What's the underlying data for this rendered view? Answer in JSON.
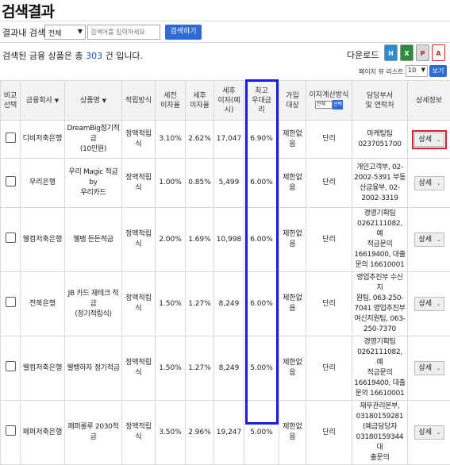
{
  "title": "검색결과",
  "search": {
    "label": "결과내 검색",
    "select_value": "전체",
    "placeholder": "검색어를 입력하세요",
    "button": "검색하기"
  },
  "result": {
    "prefix": "검색된 금융 상품은 총",
    "count": "303",
    "suffix": "건 입니다."
  },
  "download": {
    "label": "다운로드",
    "icons": [
      "hwp-icon",
      "excel-icon",
      "ppt-icon",
      "pdf-icon"
    ]
  },
  "paging": {
    "label": "페이지 뷰 리스트 :",
    "value": "10",
    "button": "보기"
  },
  "columns": {
    "compare": "비교\n선택",
    "company": "금융회사",
    "product": "상품명",
    "method": "적립방식",
    "pretax": "세전\n이자율",
    "posttax": "세후\n이자율",
    "posttax_interest": "세후\n이자(예\n시)",
    "max_rate": "최고\n우대금\n리",
    "target": "가입\n대상",
    "calc": "이자계산방식",
    "calc_select": "전체",
    "calc_btn": "선택",
    "dept": "담당부서\n및 연락처",
    "detail": "상세정보"
  },
  "rows": [
    {
      "company": "디비저축은행",
      "product": "DreamBig정기적금\n(10만원)",
      "method": "정액적립식",
      "pretax": "3.10%",
      "posttax": "2.62%",
      "interest": "17,047",
      "max_rate": "6.90%",
      "target": "제한없음",
      "calc": "단리",
      "dept": "마케팅팀\n0237051700",
      "detail": "상세"
    },
    {
      "company": "우리은행",
      "product": "우리 Magic 적금 by\n우리카드",
      "method": "정액적립식",
      "pretax": "1.00%",
      "posttax": "0.85%",
      "interest": "5,499",
      "max_rate": "6.00%",
      "target": "제한없음",
      "calc": "단리",
      "dept": "개인고객부, 02-\n2002-5391 부동\n산금융부, 02-\n2002-3319",
      "detail": "상세"
    },
    {
      "company": "웰컴저축은행",
      "product": "웰뱅 든든적금",
      "method": "정액적립식",
      "pretax": "2.00%",
      "posttax": "1.69%",
      "interest": "10,998",
      "max_rate": "6.00%",
      "target": "제한없음",
      "calc": "단리",
      "dept": "경영기획팀\n0262111082, 예\n적금문의\n16619400, 대출\n문의 16610001",
      "detail": "상세"
    },
    {
      "company": "전북은행",
      "product": "JB 카드 재테크 적금\n(정기적립식)",
      "method": "정액적립식",
      "pretax": "1.50%",
      "posttax": "1.27%",
      "interest": "8,249",
      "max_rate": "6.00%",
      "target": "제한없음",
      "calc": "단리",
      "dept": "영업추진부 수신지\n원팀, 063-250-\n7041 영업추진부\n여신지원팀, 063-\n250-7370",
      "detail": "상세"
    },
    {
      "company": "웰컴저축은행",
      "product": "웰뱅하자 정기적금",
      "method": "정액적립식",
      "pretax": "1.50%",
      "posttax": "1.27%",
      "interest": "8,249",
      "max_rate": "5.00%",
      "target": "제한없음",
      "calc": "단리",
      "dept": "경영기획팀\n0262111082, 예\n적금문의\n16619400, 대출\n문의 16610001",
      "detail": "상세"
    },
    {
      "company": "페퍼저축은행",
      "product": "페퍼룰루 2030적금",
      "method": "정액적립식",
      "pretax": "3.50%",
      "posttax": "2.96%",
      "interest": "19,247",
      "max_rate": "5.00%",
      "target": "제한없음",
      "calc": "단리",
      "dept": "재무관리본부,\n03180159281\n(예금담당자\n03180159344 대\n출문의",
      "detail": "상세"
    }
  ]
}
